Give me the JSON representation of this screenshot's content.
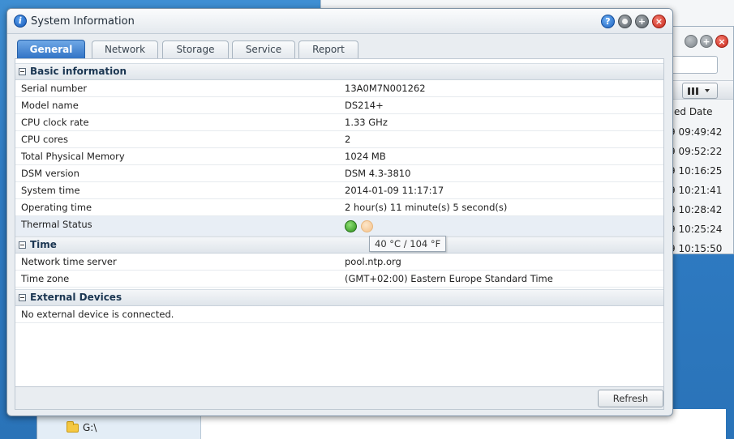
{
  "window": {
    "title": "System Information"
  },
  "tabs": [
    {
      "label": "General",
      "active": true
    },
    {
      "label": "Network",
      "active": false
    },
    {
      "label": "Storage",
      "active": false
    },
    {
      "label": "Service",
      "active": false
    },
    {
      "label": "Report",
      "active": false
    }
  ],
  "sections": {
    "basic": {
      "title": "Basic information",
      "rows": [
        {
          "key": "Serial number",
          "value": "13A0M7N001262"
        },
        {
          "key": "Model name",
          "value": "DS214+"
        },
        {
          "key": "CPU clock rate",
          "value": "1.33 GHz"
        },
        {
          "key": "CPU cores",
          "value": "2"
        },
        {
          "key": "Total Physical Memory",
          "value": "1024 MB"
        },
        {
          "key": "DSM version",
          "value": "DSM 4.3-3810"
        },
        {
          "key": "System time",
          "value": "2014-01-09 11:17:17"
        },
        {
          "key": "Operating time",
          "value": "2 hour(s) 11 minute(s) 5 second(s)"
        },
        {
          "key": "Thermal Status"
        }
      ]
    },
    "time": {
      "title": "Time",
      "rows": [
        {
          "key": "Network time server",
          "value": "pool.ntp.org"
        },
        {
          "key": "Time zone",
          "value": "(GMT+02:00) Eastern Europe Standard Time"
        }
      ]
    },
    "external": {
      "title": "External Devices",
      "message": "No external device is connected."
    }
  },
  "thermal_tooltip": "40 °C / 104 °F",
  "footer": {
    "refresh_label": "Refresh"
  },
  "background": {
    "column_header": "ed Date",
    "rows": [
      "9 09:49:42",
      "9 09:52:22",
      "9 10:16:25",
      "9 10:21:41",
      "9 10:28:42",
      "9 10:25:24",
      "9 10:15:50"
    ],
    "tree_item": "G:\\"
  },
  "colors": {
    "accent": "#2f71c4",
    "header_text": "#1b3652",
    "status_ok": "#2d8f1b",
    "status_warn": "#f3c088"
  }
}
